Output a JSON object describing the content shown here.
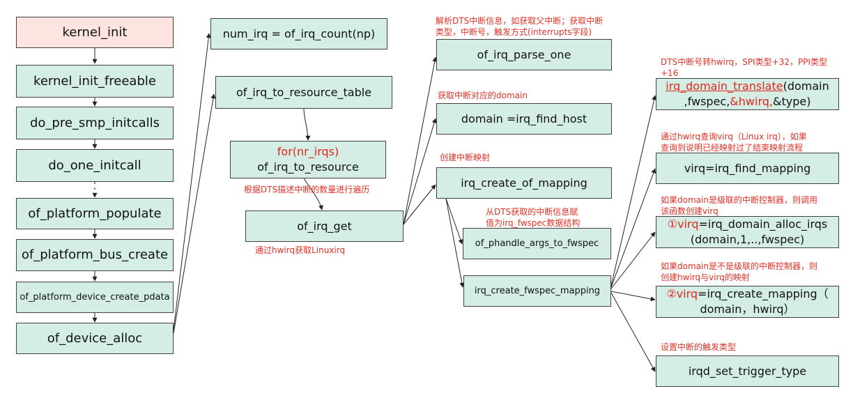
{
  "boxes": {
    "kernel_init": "kernel_init",
    "kernel_init_freeable": "kernel_init_freeable",
    "do_pre_smp_initcalls": "do_pre_smp_initcalls",
    "do_one_initcall": "do_one_initcall",
    "of_platform_populate": "of_platform_populate",
    "of_platform_bus_create": "of_platform_bus_create",
    "of_platform_device_create_pdata": "of_platform_device_create_pdata",
    "of_device_alloc": "of_device_alloc",
    "num_irq": "num_irq = of_irq_count(np)",
    "of_irq_to_resource_table": "of_irq_to_resource_table",
    "for_nr_irqs": "for(nr_irqs)",
    "of_irq_to_resource": "of_irq_to_resource",
    "of_irq_get": "of_irq_get",
    "of_irq_parse_one": "of_irq_parse_one",
    "irq_find_host": "domain =irq_find_host",
    "irq_create_of_mapping": "irq_create_of_mapping",
    "of_phandle_args_to_fwspec": "of_phandle_args_to_fwspec",
    "irq_create_fwspec_mapping": "irq_create_fwspec_mapping",
    "translate_func": "irq_domain_translate",
    "translate_arg1": "(domain",
    "translate_arg2": ",fwspec,",
    "translate_arg3": "&hwirq,",
    "translate_arg4": "&type)",
    "irq_find_mapping": "virq=irq_find_mapping",
    "alloc_num": "①virq",
    "alloc_rest": "=irq_domain_alloc_irqs",
    "alloc_args": "(domain,1,..,fwspec)",
    "create_num": "②virq",
    "create_rest": "=irq_create_mapping（",
    "create_args": "domain，hwirq）",
    "irqd_set_trigger_type": "irqd_set_trigger_type"
  },
  "notes": {
    "parse_dts_1": "解析DTS中断信息，如获取父中断；获取中断",
    "parse_dts_2": "类型，中断号，触发方式(interrupts字段)",
    "get_domain": "获取中断对应的domain",
    "create_mapping": "创建中断映射",
    "iterate_dts": "根据DTS描述中断的数量进行遍历",
    "fwspec_1": "从DTS获取的中断信息赋",
    "fwspec_2": "值为irq_fwspec数据结构",
    "hwirq_linux": "通过hwirq获取Linuxirq",
    "hwirq_convert_1": "DTS中断号转hwirq，SPI类型+32，PPI类型",
    "hwirq_convert_2": "+16",
    "query_virq_1": "通过hwirq查询virq（Linux irq），如果",
    "query_virq_2": "查询到说明已经映射过了结束映射流程",
    "cascaded_1": "如果domain是级联的中断控制器，则调用",
    "cascaded_2": "该函数创建virq",
    "not_cascaded_1": "如果domain是不是级联的中断控制器，则",
    "not_cascaded_2": "创建hwirq与virq的映射",
    "set_trigger": "设置中断的触发类型"
  },
  "colors": {
    "box_fill": "#d4eee6",
    "box_fill_pink": "#fde4e1",
    "annotation_red": "#e03024",
    "line": "#222222"
  }
}
